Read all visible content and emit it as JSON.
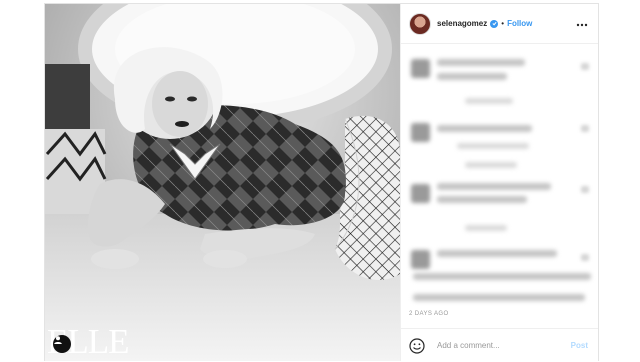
{
  "post": {
    "username": "selenagomez",
    "separator": "•",
    "follow_label": "Follow",
    "more_icon": "more-horizontal-icon",
    "verified_icon": "verified-badge-icon",
    "timestamp": "2 DAYS AGO",
    "comment_placeholder": "Add a comment...",
    "post_label": "Post",
    "emoji_icon": "emoji-smile-icon",
    "accent_color": "#3897f0"
  },
  "photo": {
    "watermark": "ELLE",
    "tag_icon": "user-tag-icon"
  }
}
